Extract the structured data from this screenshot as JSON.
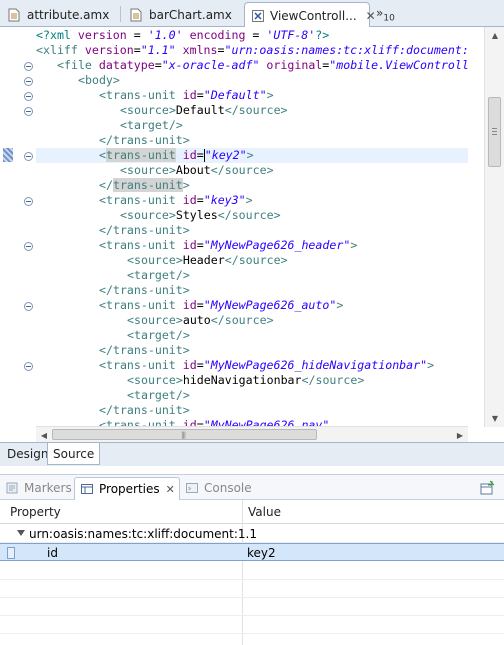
{
  "editor_tabs": [
    {
      "label": "attribute.amx",
      "active": false,
      "icon": "amx-file-icon"
    },
    {
      "label": "barChart.amx",
      "active": false,
      "icon": "amx-file-icon"
    },
    {
      "label": "ViewControll...",
      "active": true,
      "icon": "xliff-file-icon"
    }
  ],
  "tabs_overflow": {
    "symbol": "»",
    "count": "10"
  },
  "code": {
    "line1": {
      "open": "<?xml ",
      "a1": "version",
      "eq1": " = ",
      "v1": "'1.0'",
      "a2": " encoding",
      "eq2": " = ",
      "v2": "'UTF-8'",
      "close": "?>"
    },
    "line2": {
      "open": "<xliff ",
      "a1": "version",
      "eq1": "=",
      "v1": "\"1.1\"",
      "a2": " xmlns",
      "eq2": "=",
      "v2": "\"urn:oasis:names:tc:xliff:document:"
    },
    "line3": {
      "open": "<file ",
      "a1": "datatype",
      "eq1": "=",
      "v1": "\"x-oracle-adf\"",
      "a2": " original",
      "eq2": "=",
      "v2": "\"mobile.ViewControll"
    },
    "line4": {
      "tag": "<body>"
    },
    "tu_open": "<",
    "tu_name": "trans-unit",
    "id_attr": " id",
    "eq": "=",
    "tag_end": ">",
    "source_open": "<source>",
    "source_close": "</source>",
    "target": "<target/>",
    "tu_close_open": "</",
    "tu_close": "</trans-unit>",
    "units": [
      {
        "id": "\"Default\"",
        "text": "Default"
      },
      {
        "id": "\"key2\"",
        "text": "About"
      },
      {
        "id": "\"key3\"",
        "text": "Styles"
      },
      {
        "id": "\"MyNewPage626_header\"",
        "text": "Header"
      },
      {
        "id": "\"MyNewPage626_auto\"",
        "text": "auto"
      },
      {
        "id": "\"MyNewPage626_hideNavigationbar\"",
        "text": "hideNavigationbar"
      },
      {
        "id": "\"MyNewPage626_nav\""
      }
    ]
  },
  "view_tabs": [
    {
      "label": "Design",
      "active": false
    },
    {
      "label": "Source",
      "active": true
    }
  ],
  "panel_tabs": [
    {
      "label": "Markers",
      "active": false,
      "icon": "markers-icon"
    },
    {
      "label": "Properties",
      "active": true,
      "icon": "properties-icon"
    },
    {
      "label": "Console",
      "active": false,
      "icon": "console-icon"
    }
  ],
  "properties": {
    "columns": [
      "Property",
      "Value"
    ],
    "group": "urn:oasis:names:tc:xliff:document:1.1",
    "rows": [
      {
        "property": "id",
        "value": "key2",
        "selected": true
      }
    ]
  },
  "colors": {
    "tag": "#3f7f7f",
    "attribute": "#7f007f",
    "value": "#2a00ff",
    "current_line": "#e8f2fe",
    "selection": "#d4e6fa"
  }
}
